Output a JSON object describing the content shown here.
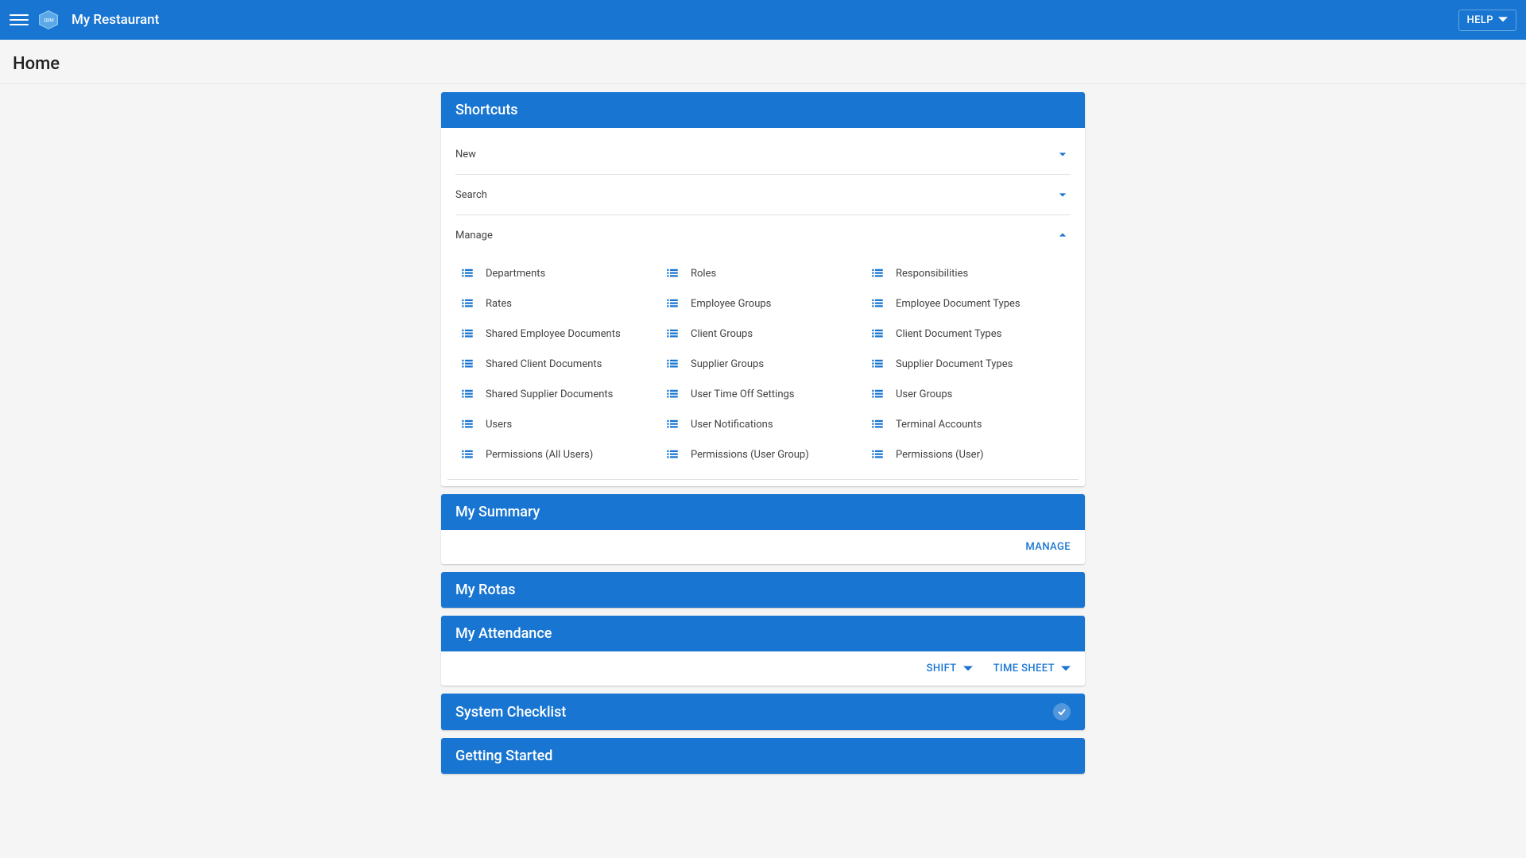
{
  "colors": {
    "primary": "#1875D1"
  },
  "appbar": {
    "title": "My Restaurant",
    "help": "HELP"
  },
  "page": {
    "title": "Home"
  },
  "shortcuts": {
    "title": "Shortcuts",
    "sections": {
      "new": {
        "label": "New",
        "expanded": false
      },
      "search": {
        "label": "Search",
        "expanded": false
      },
      "manage": {
        "label": "Manage",
        "expanded": true,
        "items": [
          "Departments",
          "Roles",
          "Responsibilities",
          "Rates",
          "Employee Groups",
          "Employee Document Types",
          "Shared Employee Documents",
          "Client Groups",
          "Client Document Types",
          "Shared Client Documents",
          "Supplier Groups",
          "Supplier Document Types",
          "Shared Supplier Documents",
          "User Time Off Settings",
          "User Groups",
          "Users",
          "User Notifications",
          "Terminal Accounts",
          "Permissions (All Users)",
          "Permissions (User Group)",
          "Permissions (User)"
        ]
      }
    }
  },
  "summary": {
    "title": "My Summary",
    "manage_label": "MANAGE"
  },
  "rotas": {
    "title": "My Rotas"
  },
  "attendance": {
    "title": "My Attendance",
    "shift_label": "SHIFT",
    "timesheet_label": "TIME SHEET"
  },
  "checklist": {
    "title": "System Checklist"
  },
  "getting_started": {
    "title": "Getting Started"
  }
}
